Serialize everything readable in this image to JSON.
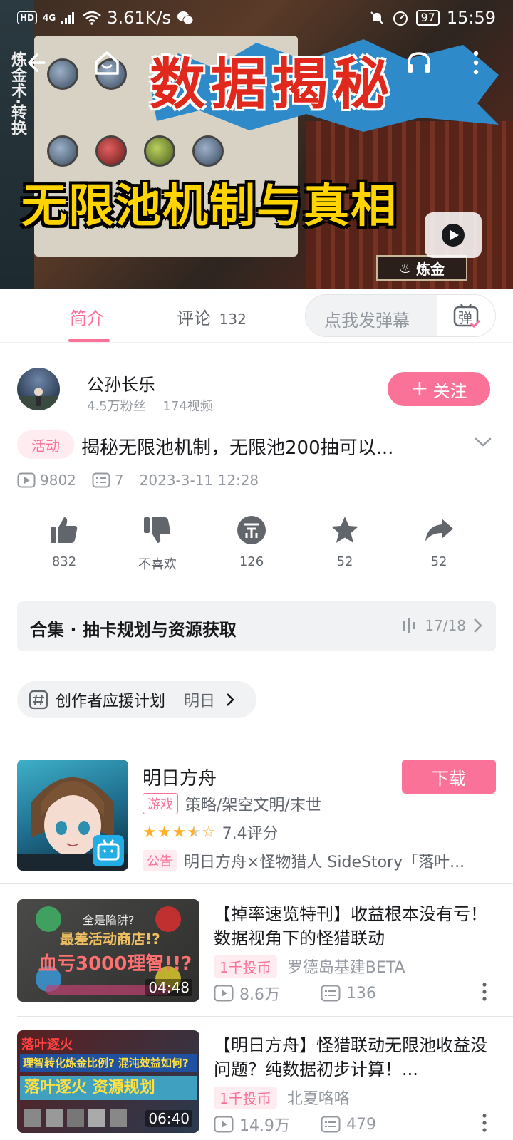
{
  "status_bar": {
    "hd": "HD",
    "network": "4G",
    "speed": "3.61K/s",
    "battery": "97",
    "time": "15:59"
  },
  "video": {
    "cover_title_top": "数据揭秘",
    "cover_title_bottom": "无限池机制与真相",
    "cover_side_text": "炼金术·转换",
    "cover_button_label": "炼金"
  },
  "tabs": {
    "intro_label": "简介",
    "comments_label": "评论",
    "comments_count": "132",
    "danmaku_placeholder": "点我发弹幕",
    "danmaku_toggle_label": "弹"
  },
  "uploader": {
    "name": "公孙长乐",
    "fans": "4.5万粉丝",
    "videos": "174视频",
    "follow_label": "关注"
  },
  "info": {
    "tag": "活动",
    "title": "揭秘无限池机制，无限池200抽可以...",
    "plays": "9802",
    "danmaku_count": "7",
    "date": "2023-3-11 12:28"
  },
  "actions": {
    "like": "832",
    "dislike": "不喜欢",
    "coin": "126",
    "favorite": "52",
    "share": "52"
  },
  "collection": {
    "title": "合集 · 抽卡规划与资源获取",
    "progress": "17/18"
  },
  "topic": {
    "text": "创作者应援计划",
    "next": "明日"
  },
  "game": {
    "name": "明日方舟",
    "download_label": "下载",
    "category_tag": "游戏",
    "category": "策略/架空文明/末世",
    "rating_value": 3.5,
    "rating_text": "7.4评分",
    "notice_tag": "公告",
    "notice": "明日方舟×怪物猎人 SideStory「落叶..."
  },
  "related": [
    {
      "thumb_line1": "全是陷阱?",
      "thumb_line2": "最差活动商店!?",
      "thumb_line3": "血亏3000理智!!?",
      "duration": "04:48",
      "title": "【掉率速览特刊】收益根本没有亏！数据视角下的怪猎联动",
      "coin_tag": "1千投币",
      "up": "罗德岛基建BETA",
      "plays": "8.6万",
      "danmaku": "136"
    },
    {
      "thumb_line1": "落叶逐火",
      "thumb_line2": "理智转化炼金比例? 混沌效益如何?",
      "thumb_line3": "落叶逐火 资源规划",
      "duration": "06:40",
      "title": "【明日方舟】怪猎联动无限池收益没问题？纯数据初步计算！...",
      "coin_tag": "1千投币",
      "up": "北夏咯咯",
      "plays": "14.9万",
      "danmaku": "479"
    }
  ],
  "colors": {
    "accent": "#fb7299",
    "text": "#18191c",
    "muted": "#9499a0"
  }
}
